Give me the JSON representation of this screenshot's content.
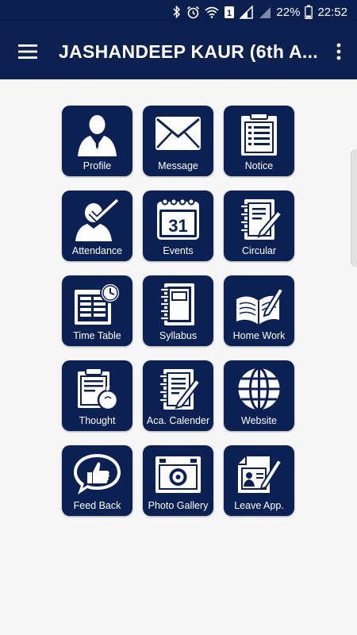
{
  "status_bar": {
    "battery_percent": "22%",
    "time": "22:52",
    "sim_badge": "1",
    "icons": [
      "bluetooth-icon",
      "alarm-icon",
      "wifi-icon",
      "sim-icon",
      "signal-icon",
      "battery-icon"
    ]
  },
  "app_bar": {
    "title": "JASHANDEEP KAUR (6th A...",
    "menu_icon": "hamburger-menu-icon",
    "more_icon": "more-vert-icon"
  },
  "tiles": [
    {
      "label": "Profile",
      "icon": "profile-icon"
    },
    {
      "label": "Message",
      "icon": "envelope-icon"
    },
    {
      "label": "Notice",
      "icon": "notice-board-icon"
    },
    {
      "label": "Attendance",
      "icon": "attendance-icon"
    },
    {
      "label": "Events",
      "icon": "calendar-icon",
      "badge": "31"
    },
    {
      "label": "Circular",
      "icon": "circular-notebook-icon"
    },
    {
      "label": "Time Table",
      "icon": "time-table-icon"
    },
    {
      "label": "Syllabus",
      "icon": "syllabus-notebook-icon"
    },
    {
      "label": "Home Work",
      "icon": "open-book-pen-icon"
    },
    {
      "label": "Thought",
      "icon": "thought-clipboard-icon"
    },
    {
      "label": "Aca. Calender",
      "icon": "academic-calendar-icon"
    },
    {
      "label": "Website",
      "icon": "globe-icon"
    },
    {
      "label": "Feed Back",
      "icon": "thumbs-up-bubble-icon"
    },
    {
      "label": "Photo Gallery",
      "icon": "camera-icon"
    },
    {
      "label": "Leave App.",
      "icon": "leave-application-icon"
    }
  ],
  "colors": {
    "status_bar": "#0a1f4d",
    "app_bar": "#0c2150",
    "tile": "#0b2154",
    "background": "#f6f6f6"
  }
}
